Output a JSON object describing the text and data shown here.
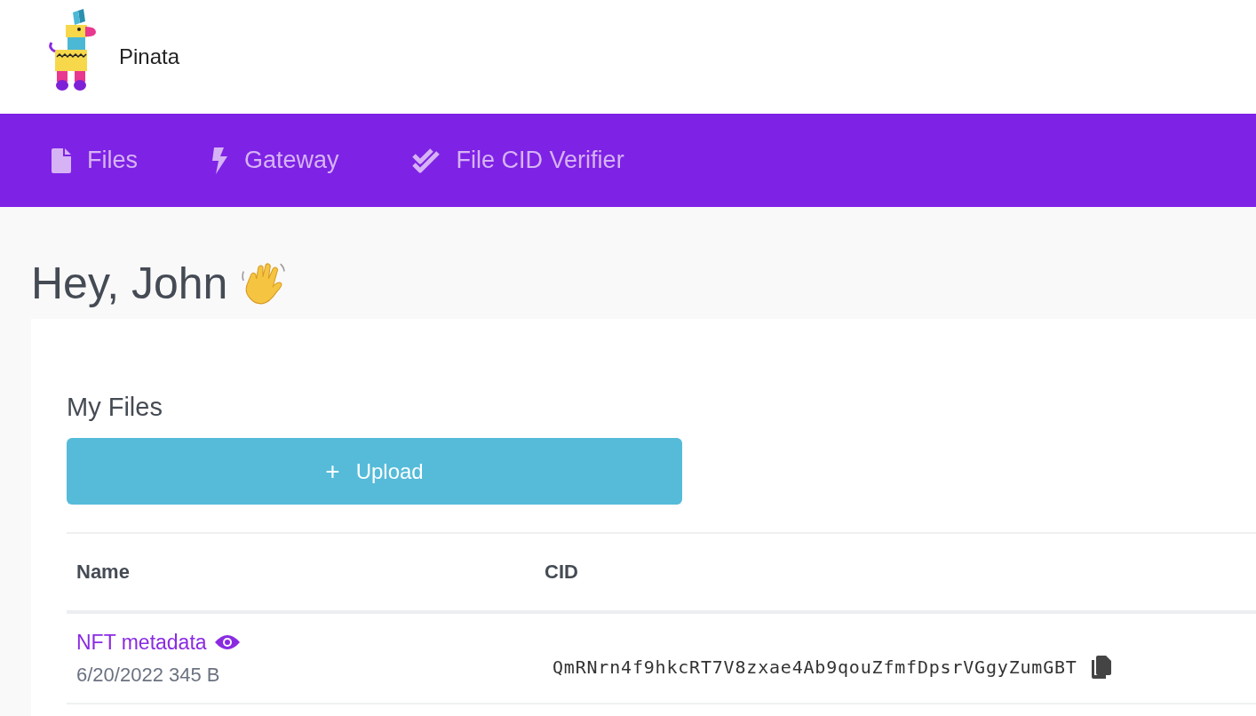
{
  "brand": {
    "name": "Pinata"
  },
  "nav": [
    {
      "label": "Files"
    },
    {
      "label": "Gateway"
    },
    {
      "label": "File CID Verifier"
    }
  ],
  "greeting": "Hey, John",
  "files": {
    "title": "My Files",
    "upload_button": "Upload",
    "upload_icon": "+",
    "columns": [
      "Name",
      "CID"
    ],
    "rows": [
      {
        "name": "NFT metadata",
        "meta": "6/20/2022 345 B",
        "cid": "QmRNrn4f9hkcRT7V8zxae4Ab9qouZfmfDpsrVGgyZumGBT"
      }
    ]
  }
}
